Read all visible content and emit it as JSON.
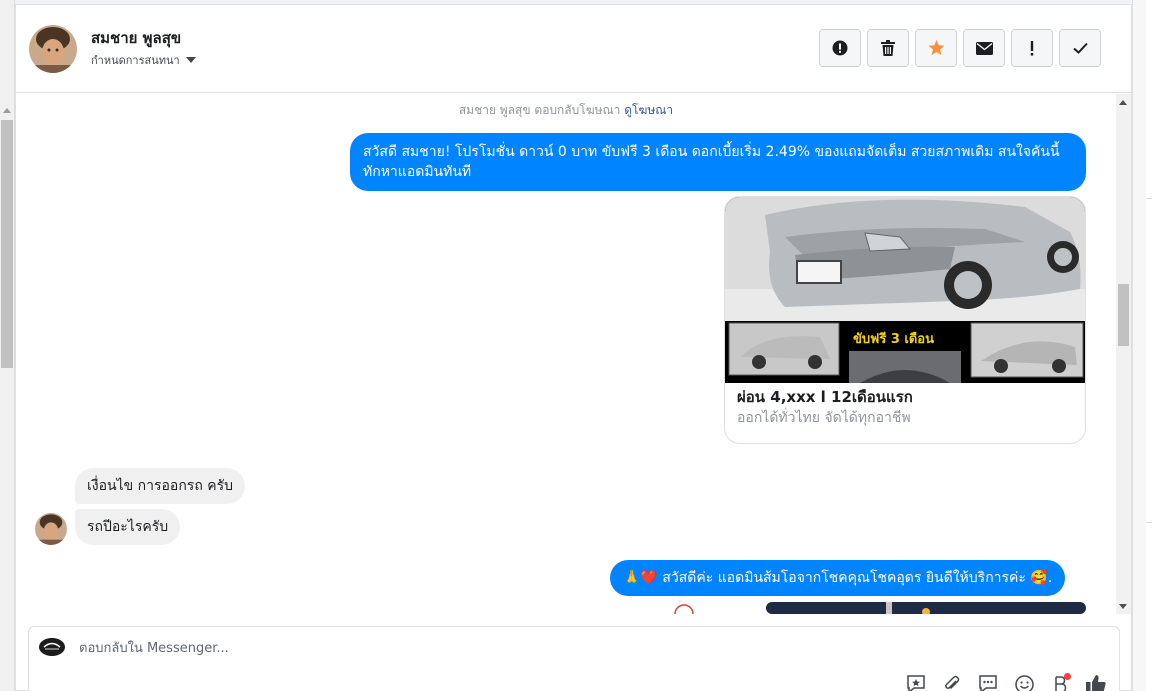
{
  "contact": {
    "name": "สมชาย พูลสุข",
    "label_dropdown": "กำหนดการสนทนา"
  },
  "actions": [
    {
      "name": "report-spam-button",
      "icon": "exclamation-circle-icon"
    },
    {
      "name": "delete-button",
      "icon": "trash-icon"
    },
    {
      "name": "star-button",
      "icon": "star-icon",
      "color": "#f7923b"
    },
    {
      "name": "mark-unread-button",
      "icon": "envelope-icon"
    },
    {
      "name": "important-button",
      "icon": "exclamation-icon"
    },
    {
      "name": "done-button",
      "icon": "check-icon"
    }
  ],
  "conversation": {
    "ad_notice_prefix": "สมชาย พูลสุข ตอบกลับโฆษณา",
    "ad_notice_link": "ดูโฆษณา",
    "page_message_1": "สวัสดี สมชาย! โปรโมชั่น ดาวน์ 0 บาท ขับฟรี 3 เดือน ดอกเบี้ยเริ่ม 2.49% ของแถมจัดเต็ม สวยสภาพเดิม สนใจคันนี้ทักหาแอดมินทันที",
    "ad_card": {
      "image_caption": "ขับฟรี 3 เดือน",
      "title": "ผ่อน 4,xxx l 12เดือนแรก",
      "subtitle": "ออกได้ทั่วไทย จัดได้ทุกอาชีพ"
    },
    "customer_message_1": "เงื่อนไข การออกรถ ครับ",
    "customer_message_2": "รถปีอะไรครับ",
    "page_message_2": "🙏❤️ สวัสดีค่ะ แอดมินส้มโอจากโชคคุณโชคอุดร ยินดีให้บริการค่ะ 🥰."
  },
  "composer": {
    "placeholder": "ตอบกลับใน Messenger..."
  },
  "colors": {
    "accent": "#0084ff",
    "star": "#f7923b"
  }
}
